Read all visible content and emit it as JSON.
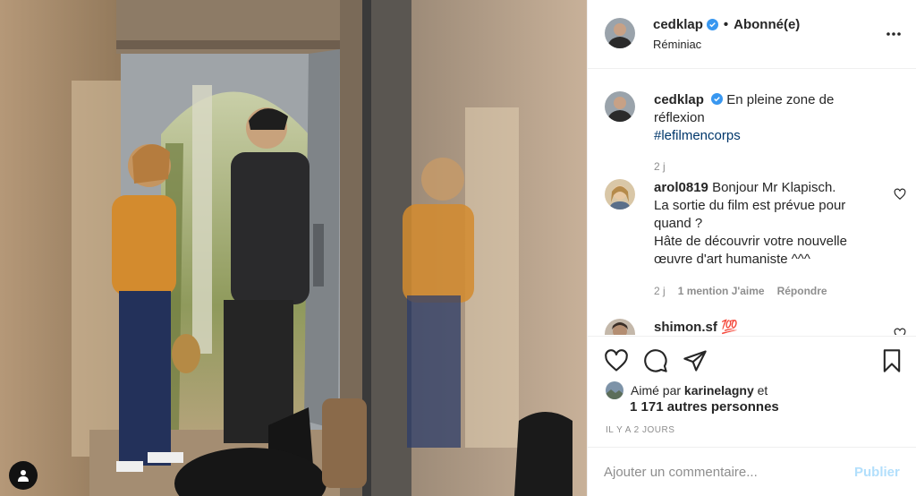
{
  "post": {
    "username": "cedklap",
    "follow_status": "Abonné(e)",
    "location": "Réminiac"
  },
  "comments": [
    {
      "username": "cedklap",
      "text": "En pleine zone de réflexion",
      "hashtag": "#lefilmencorps",
      "age": "2 j"
    },
    {
      "username": "arol0819",
      "lines": [
        "Bonjour Mr Klapisch.",
        "La sortie du film est prévue pour",
        "quand ?",
        "Hâte de découvrir votre nouvelle",
        "œuvre d'art humaniste ^^^"
      ],
      "age": "2 j",
      "likes": "1 mention J'aime",
      "reply_label": "Répondre"
    },
    {
      "username": "shimon.sf",
      "emoji": "💯"
    }
  ],
  "likes": {
    "prefix": "Aimé par",
    "liker": "karinelagny",
    "conj": "et",
    "others": "1 171 autres personnes"
  },
  "timestamp": "IL Y A 2 JOURS",
  "add_comment": {
    "placeholder": "Ajouter un commentaire...",
    "publish_label": "Publier"
  },
  "icons": [
    "verified-badge-icon",
    "more-options-icon",
    "heart-icon",
    "comment-icon",
    "share-icon",
    "bookmark-icon",
    "user-tag-icon"
  ],
  "colors": {
    "verified": "#3897f0",
    "hashtag": "#00376b",
    "publish_disabled": "#b2dffc",
    "muted": "#8e8e8e"
  }
}
